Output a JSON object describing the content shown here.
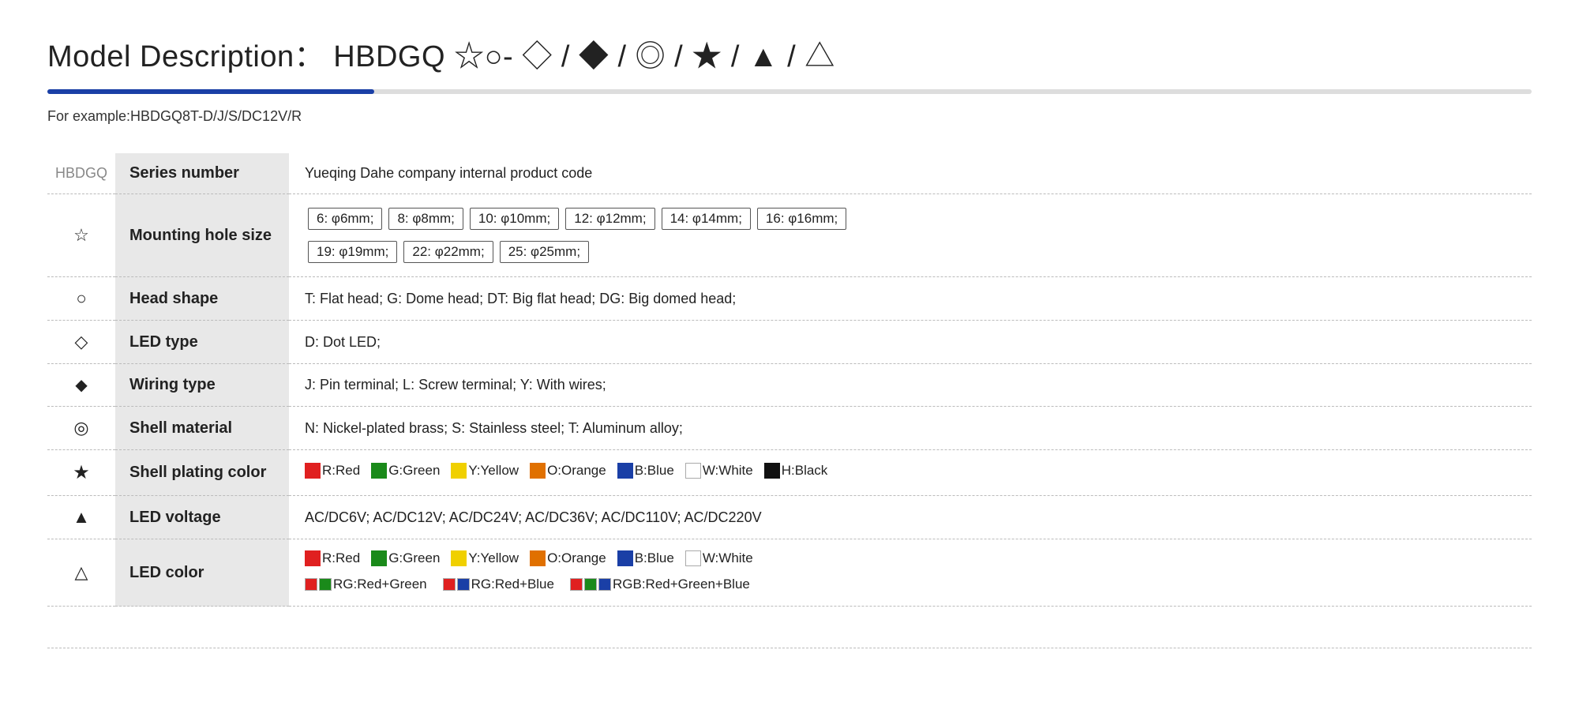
{
  "title": {
    "text": "Model Description： HBDGQ ☆○- ◇ / ◆ / ◎ / ★ / ▲ / △"
  },
  "progress": {
    "fill_percent": 22
  },
  "example": {
    "text": "For example:HBDGQ8T-D/J/S/DC12V/R"
  },
  "rows": [
    {
      "icon": "☆",
      "icon_name": "star-outline-icon",
      "label": "Series number",
      "prefix": "HBDGQ",
      "value": "Yueqing Dahe company internal product code",
      "type": "series"
    },
    {
      "icon": "☆",
      "icon_name": "star-outline-icon",
      "label": "Mounting hole size",
      "value": "hole_sizes",
      "type": "holes"
    },
    {
      "icon": "○",
      "icon_name": "circle-outline-icon",
      "label": "Head  shape",
      "value": "T: Flat head;   G: Dome head;   DT: Big flat head;   DG: Big domed head;",
      "type": "text"
    },
    {
      "icon": "◇",
      "icon_name": "diamond-outline-icon",
      "label": "LED type",
      "value": "D: Dot LED;",
      "type": "text"
    },
    {
      "icon": "◆",
      "icon_name": "diamond-solid-icon",
      "label": "Wiring type",
      "value": "J: Pin terminal;   L: Screw terminal;   Y: With wires;",
      "type": "text"
    },
    {
      "icon": "◎",
      "icon_name": "circle-double-icon",
      "label": "Shell material",
      "value": "N: Nickel-plated brass;   S: Stainless steel;   T: Aluminum alloy;",
      "type": "text"
    },
    {
      "icon": "★",
      "icon_name": "star-solid-icon",
      "label": "Shell plating color",
      "value": "colors_plating",
      "type": "colors_plating"
    },
    {
      "icon": "▲",
      "icon_name": "triangle-solid-icon",
      "label": "LED voltage",
      "value": "AC/DC6V;   AC/DC12V;   AC/DC24V;   AC/DC36V;   AC/DC110V;   AC/DC220V",
      "type": "text"
    },
    {
      "icon": "△",
      "icon_name": "triangle-outline-icon",
      "label": "LED color",
      "value": "colors_led",
      "type": "colors_led"
    }
  ],
  "hole_sizes": [
    "6: φ6mm;",
    "8: φ8mm;",
    "10: φ10mm;",
    "12: φ12mm;",
    "14: φ14mm;",
    "16: φ16mm;",
    "19: φ19mm;",
    "22: φ22mm;",
    "25: φ25mm;"
  ],
  "colors_plating": [
    {
      "color": "#e02020",
      "label": "R:Red"
    },
    {
      "color": "#1a8a1a",
      "label": "G:Green"
    },
    {
      "color": "#f0d000",
      "label": "Y:Yellow"
    },
    {
      "color": "#e07000",
      "label": "O:Orange"
    },
    {
      "color": "#1a3fa6",
      "label": "B:Blue"
    },
    {
      "color": "#ffffff",
      "label": "W:White",
      "outline": true
    },
    {
      "color": "#111111",
      "label": "H:Black"
    }
  ],
  "colors_led_basic": [
    {
      "color": "#e02020",
      "label": "R:Red"
    },
    {
      "color": "#1a8a1a",
      "label": "G:Green"
    },
    {
      "color": "#f0d000",
      "label": "Y:Yellow"
    },
    {
      "color": "#e07000",
      "label": "O:Orange"
    },
    {
      "color": "#1a3fa6",
      "label": "B:Blue"
    },
    {
      "color": "#ffffff",
      "label": "W:White",
      "outline": true
    }
  ],
  "colors_led_combo": [
    {
      "swatches": [
        "#e02020",
        "#1a8a1a"
      ],
      "label": "RG:Red+Green"
    },
    {
      "swatches": [
        "#e02020",
        "#1a3fa6"
      ],
      "label": "RG:Red+Blue"
    },
    {
      "swatches": [
        "#e02020",
        "#1a8a1a",
        "#1a3fa6"
      ],
      "label": "RGB:Red+Green+Blue"
    }
  ]
}
